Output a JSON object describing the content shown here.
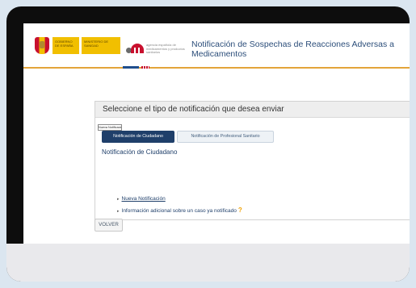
{
  "header": {
    "gov_line1": "Gobierno de España",
    "gov_line2": "Ministerio de Sanidad",
    "agency_text": "agencia española de medicamentos y productos sanitarios",
    "site_title": "Notificación de Sospechas de Reacciones Adversas a Medicamentos"
  },
  "panel": {
    "title": "Seleccione el tipo de notificación que desea enviar",
    "tabs": [
      {
        "label": "Notificación de Ciudadano",
        "active": true
      },
      {
        "label": "Notificación de Profesional Sanitario",
        "active": false
      }
    ],
    "section_title": "Notificación de Ciudadano",
    "links": [
      {
        "label": "Nueva Notificación"
      },
      {
        "label": "Información adicional sobre un caso ya notificado",
        "help_icon": "question-icon"
      }
    ],
    "tooltip": "Nueva Notificación"
  },
  "back_button": "VOLVER",
  "colors": {
    "accent_blue": "#1f3f6a",
    "brand_red": "#c8102e",
    "gov_yellow": "#f1bf00",
    "rule_orange": "#e3a43a",
    "help_orange": "#f0a000"
  }
}
